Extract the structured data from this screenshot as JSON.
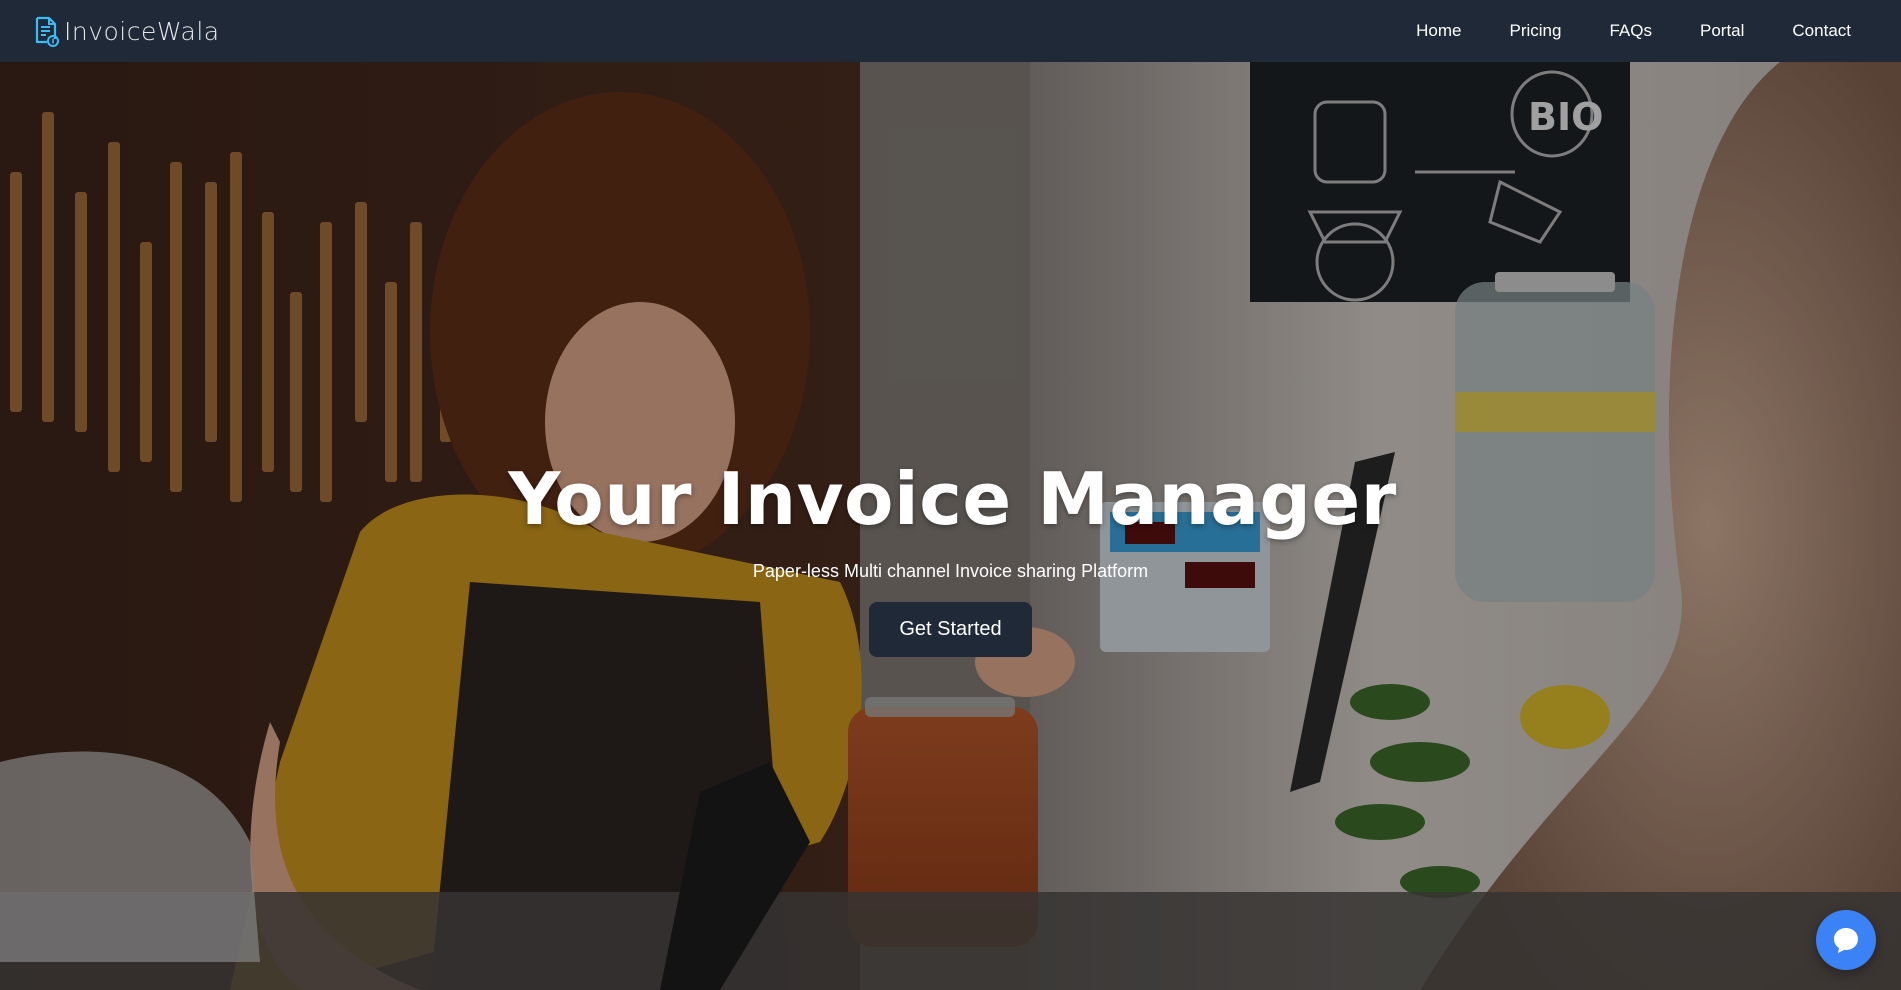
{
  "brand": {
    "name": "InvoiceWala",
    "logo_icon": "invoice-document-icon",
    "logo_color": "#38bdf8"
  },
  "nav": {
    "items": [
      {
        "label": "Home"
      },
      {
        "label": "Pricing"
      },
      {
        "label": "FAQs"
      },
      {
        "label": "Portal"
      },
      {
        "label": "Contact"
      }
    ]
  },
  "hero": {
    "title": "Your Invoice Manager",
    "subtitle": "Paper-less Multi channel Invoice sharing Platform",
    "cta_label": "Get Started",
    "background_image": "shop-counter-photo",
    "chalkboard_text": "BIO"
  },
  "chat_widget": {
    "icon": "chat-bubble-icon",
    "color": "#3b82f6"
  },
  "colors": {
    "navbar": "#1f2937",
    "button": "#1f2937",
    "text": "#ffffff"
  }
}
